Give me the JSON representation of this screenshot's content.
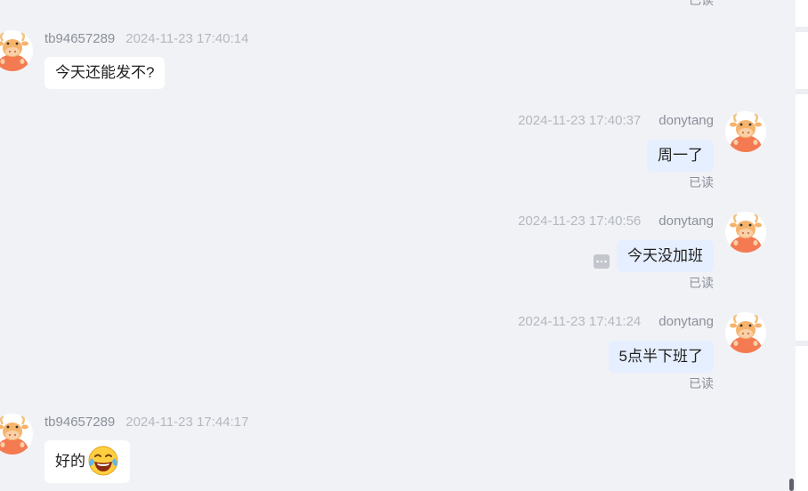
{
  "conversation": {
    "top_read_status": "已读",
    "messages": [
      {
        "side": "left",
        "sender": "tb94657289",
        "time": "2024-11-23 17:40:14",
        "text": "今天还能发不?"
      },
      {
        "side": "right",
        "sender": "donytang",
        "time": "2024-11-23 17:40:37",
        "text": "周一了",
        "status": "已读"
      },
      {
        "side": "right",
        "sender": "donytang",
        "time": "2024-11-23 17:40:56",
        "text": "今天没加班",
        "status": "已读"
      },
      {
        "side": "right",
        "sender": "donytang",
        "time": "2024-11-23 17:41:24",
        "text": "5点半下班了",
        "status": "已读"
      },
      {
        "side": "left",
        "sender": "tb94657289",
        "time": "2024-11-23 17:44:17",
        "text": "好的",
        "emoji": "laughing-tears-emoji"
      }
    ]
  },
  "icons": {
    "avatar": "cow-avatar-icon",
    "more": "more-options-icon"
  },
  "colors": {
    "background": "#f1f2f6",
    "left_bubble": "#ffffff",
    "right_bubble": "#e6efff",
    "avatar_accent": "#f47a51"
  }
}
